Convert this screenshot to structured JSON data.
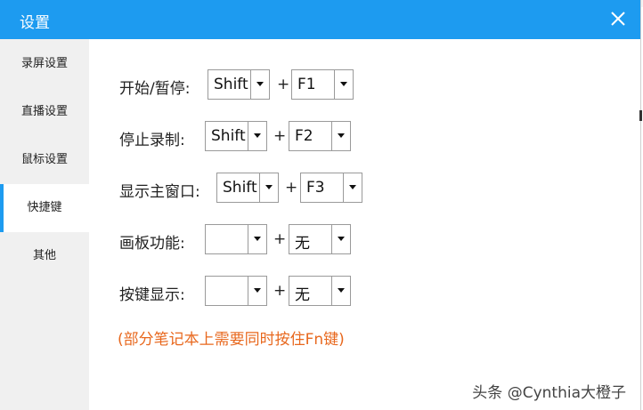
{
  "window": {
    "title": "设置"
  },
  "sidebar": {
    "items": [
      {
        "label": "录屏设置"
      },
      {
        "label": "直播设置"
      },
      {
        "label": "鼠标设置"
      },
      {
        "label": "快捷键",
        "active": true
      },
      {
        "label": "其他"
      }
    ]
  },
  "shortcuts": [
    {
      "label": "开始/暂停:",
      "modifier": "Shift",
      "key": "F1"
    },
    {
      "label": "停止录制:",
      "modifier": "Shift",
      "key": "F2"
    },
    {
      "label": "显示主窗口:",
      "modifier": "Shift",
      "key": "F3"
    },
    {
      "label": "画板功能:",
      "modifier": "",
      "key": "无"
    },
    {
      "label": "按键显示:",
      "modifier": "",
      "key": "无"
    }
  ],
  "plus_sign": "+",
  "note": "(部分笔记本上需要同时按住Fn键)",
  "watermark": "头条 @Cynthia大橙子",
  "colors": {
    "accent": "#1d9bf0",
    "note": "#e8681e",
    "sidebar_bg": "#f0f0f0"
  },
  "icons": {
    "close": "close-icon",
    "dropdown": "chevron-down-icon"
  }
}
